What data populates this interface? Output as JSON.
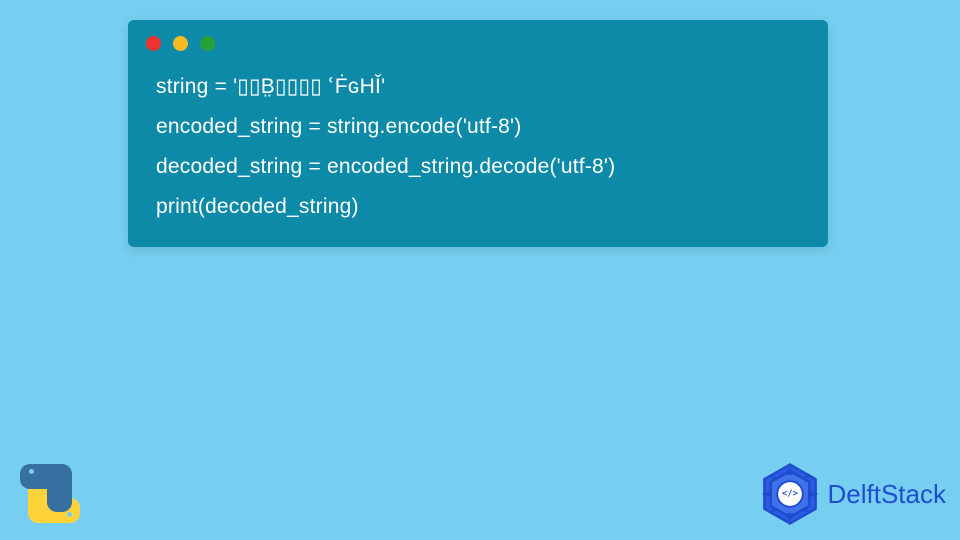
{
  "code": {
    "lines": [
      "string = '▯▯B̤▯▯▯▯ ՙḞɢHǏ'",
      "encoded_string = string.encode('utf-8')",
      "decoded_string = encoded_string.decode('utf-8')",
      "print(decoded_string)"
    ]
  },
  "window_dots": {
    "red": "#ed3330",
    "yellow": "#f4bb25",
    "green": "#27a037"
  },
  "branding": {
    "delftstack_text": "DelftStack",
    "python_logo": "python-icon"
  },
  "colors": {
    "page_bg": "#76cff0",
    "card_bg": "#0d8aa7",
    "code_text": "#ffffff",
    "brand_blue": "#1f4cd1"
  }
}
